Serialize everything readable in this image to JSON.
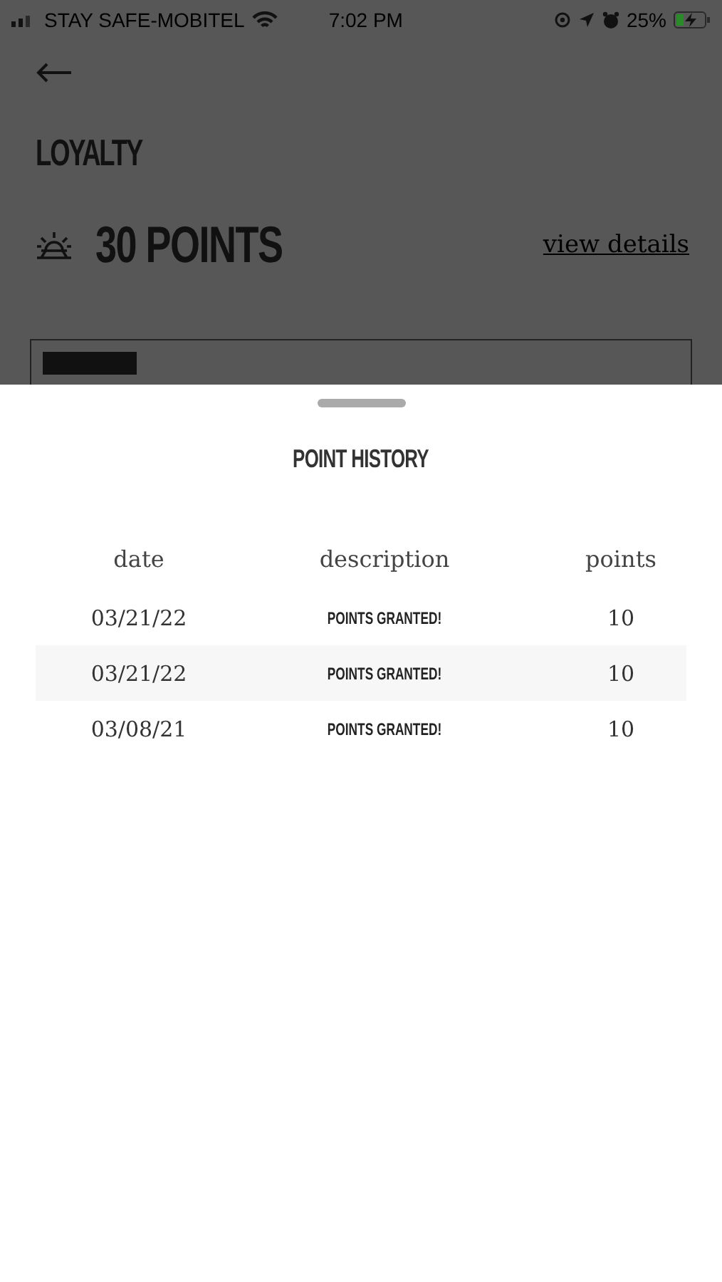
{
  "status_bar": {
    "carrier": "STAY SAFE-MOBITEL",
    "time": "7:02 PM",
    "battery": "25%"
  },
  "page": {
    "title": "LOYALTY",
    "points": "30 POINTS",
    "link": "view details"
  },
  "sheet": {
    "title": "POINT HISTORY",
    "columns": [
      "date",
      "description",
      "points"
    ],
    "rows": [
      {
        "date": "03/21/22",
        "description": "POINTS GRANTED!",
        "points": "10"
      },
      {
        "date": "03/21/22",
        "description": "POINTS GRANTED!",
        "points": "10"
      },
      {
        "date": "03/08/21",
        "description": "POINTS GRANTED!",
        "points": "10"
      }
    ]
  }
}
